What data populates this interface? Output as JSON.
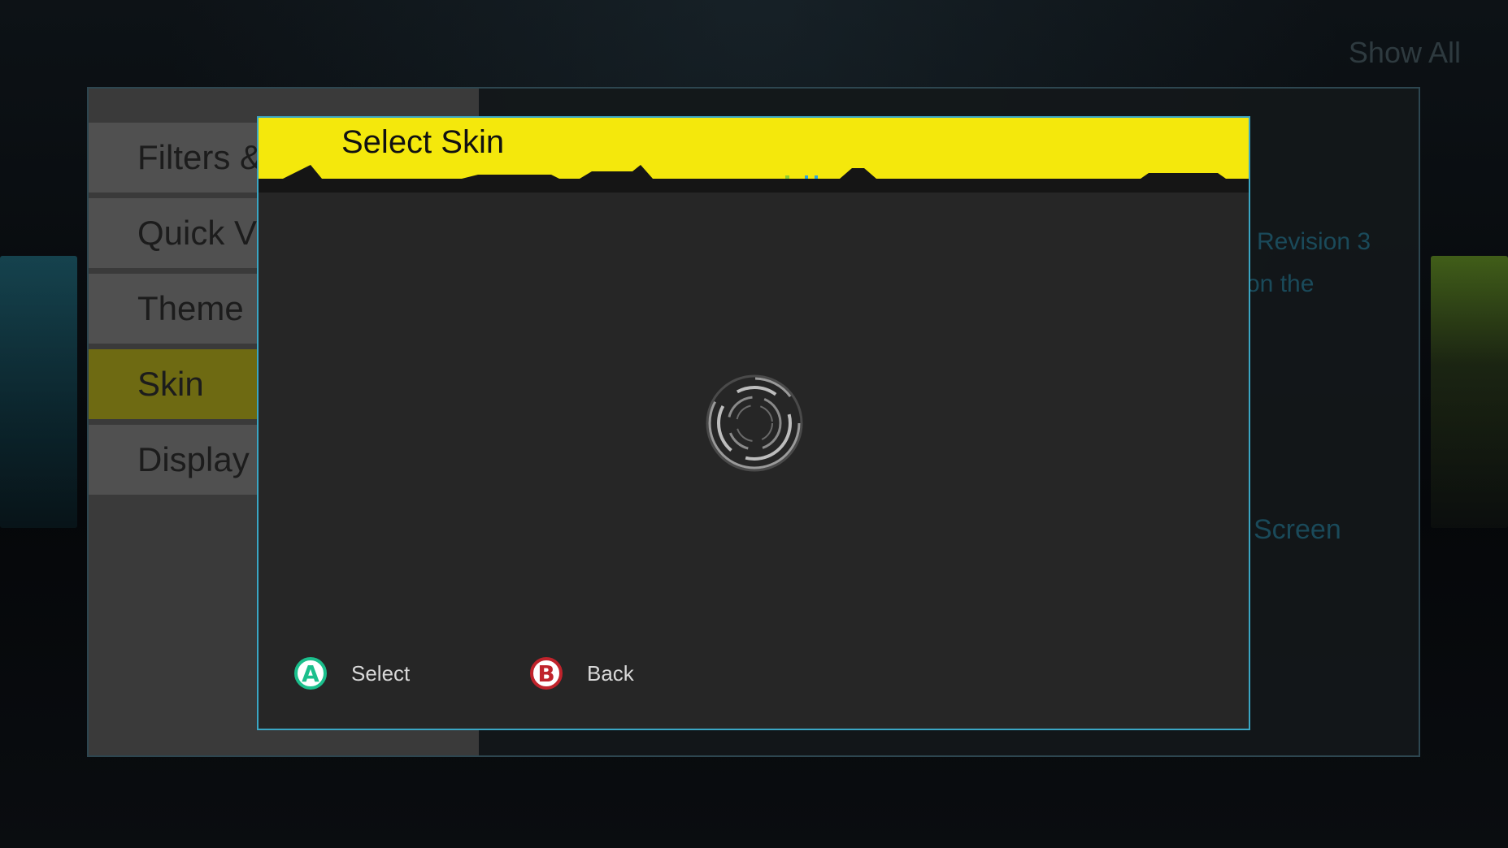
{
  "top_right": {
    "show_all": "Show All"
  },
  "menu": {
    "items": [
      {
        "label": "Filters &"
      },
      {
        "label": "Quick V"
      },
      {
        "label": "Theme"
      },
      {
        "label": "Skin"
      },
      {
        "label": "Display"
      }
    ],
    "active_index": 3
  },
  "background_panel": {
    "line1": "Revision 3",
    "line2": "on the",
    "line3": "Screen"
  },
  "dialog": {
    "title": "Select Skin",
    "buttons": [
      {
        "glyph": "A",
        "label": "Select"
      },
      {
        "glyph": "B",
        "label": "Back"
      }
    ]
  },
  "colors": {
    "header_yellow": "#f4e80c",
    "dialog_border": "#3aa6c4",
    "active_item": "#6e6a12",
    "button_a": "#1bbf8c",
    "button_b": "#c0232b"
  }
}
